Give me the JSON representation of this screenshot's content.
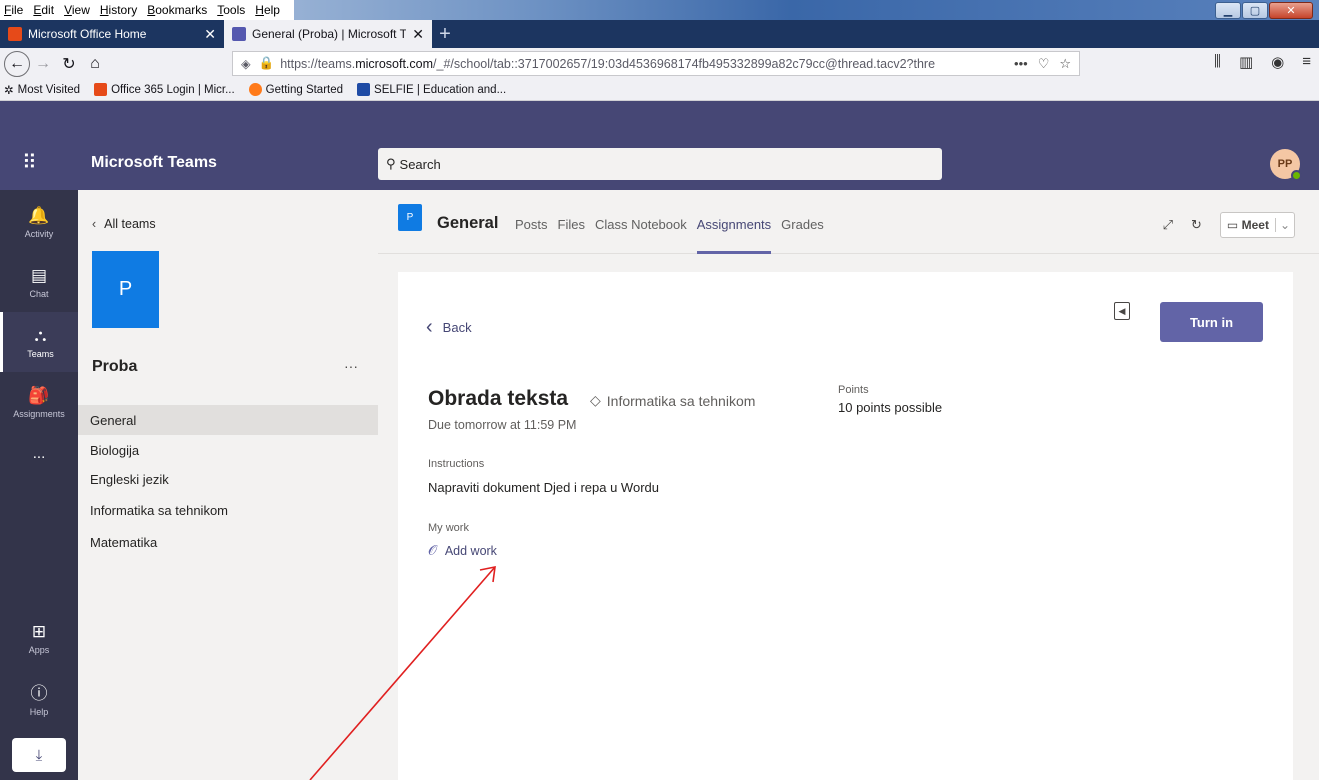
{
  "browser": {
    "menu": [
      "File",
      "Edit",
      "View",
      "History",
      "Bookmarks",
      "Tools",
      "Help"
    ],
    "tabs": [
      {
        "title": "Microsoft Office Home",
        "close": "✕"
      },
      {
        "title": "General (Proba) | Microsoft Tea",
        "close": "✕"
      }
    ],
    "new_tab": "+",
    "url": {
      "prefix": "https://teams.",
      "domain": "microsoft.com",
      "path": "/_#/school/tab::3717002657/19:03d4536968174fb495332899a82c79cc@thread.tacv2?thre"
    },
    "bookmarks": [
      "Most Visited",
      "Office 365 Login | Micr...",
      "Getting Started",
      "SELFIE | Education and..."
    ]
  },
  "teams": {
    "app_name": "Microsoft Teams",
    "search_placeholder": "Search",
    "avatar_initials": "PP",
    "rail": [
      "Activity",
      "Chat",
      "Teams",
      "Assignments",
      "...",
      "Apps",
      "Help"
    ],
    "all_teams": "All teams",
    "team_initial": "P",
    "team_name": "Proba",
    "team_more": "···",
    "channels": [
      "General",
      "Biologija",
      "Engleski jezik",
      "Informatika sa tehnikom",
      "Matematika"
    ],
    "channel_header": {
      "icon_letter": "P",
      "title": "General",
      "tabs": [
        "Posts",
        "Files",
        "Class Notebook",
        "Assignments",
        "Grades"
      ],
      "meet": "Meet"
    },
    "assignment": {
      "back": "Back",
      "turn_in": "Turn in",
      "title": "Obrada teksta",
      "category": "Informatika sa tehnikom",
      "due": "Due tomorrow at 11:59 PM",
      "points_label": "Points",
      "points_value": "10 points possible",
      "instructions_label": "Instructions",
      "instructions": "Napraviti dokument Djed i repa u Wordu",
      "my_work_label": "My work",
      "add_work": "Add work"
    }
  },
  "colors": {
    "teams_purple": "#464775",
    "accent": "#6264a7",
    "rail": "#33344a",
    "annotation": "#e02020"
  }
}
